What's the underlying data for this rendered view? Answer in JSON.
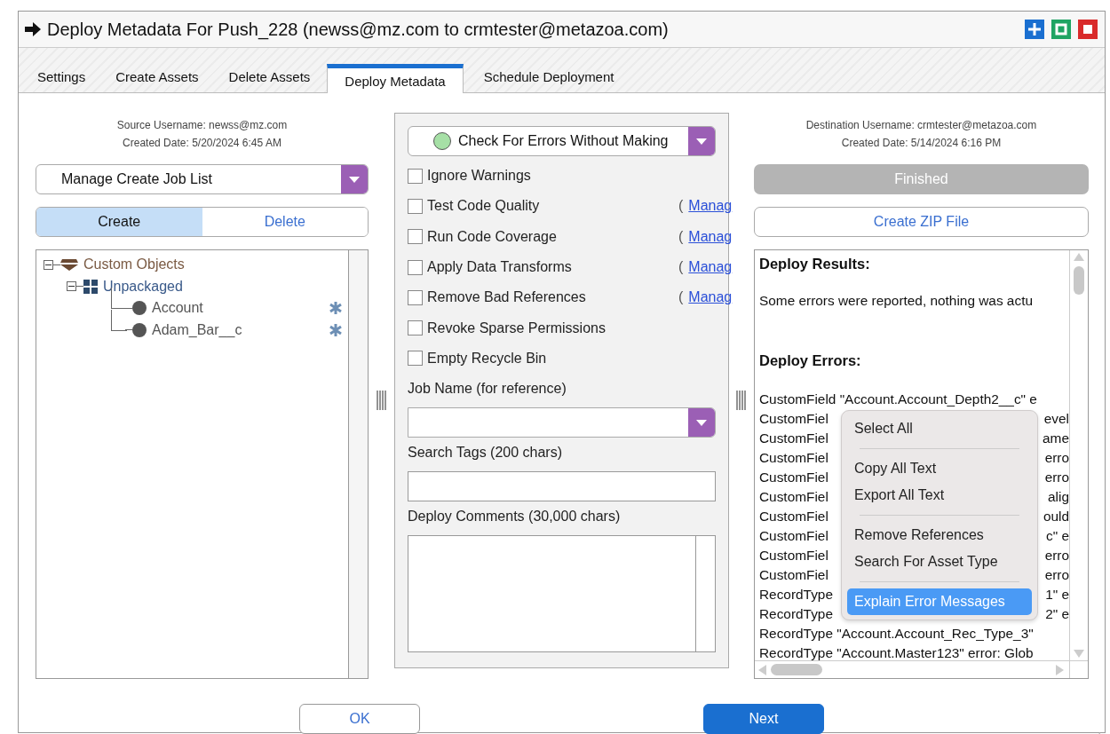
{
  "window": {
    "title": "Deploy Metadata For Push_228 (newss@mz.com to crmtester@metazoa.com)"
  },
  "tabs": [
    {
      "label": "Settings",
      "selected": false
    },
    {
      "label": "Create Assets",
      "selected": false
    },
    {
      "label": "Delete Assets",
      "selected": false
    },
    {
      "label": "Deploy Metadata",
      "selected": true
    },
    {
      "label": "Schedule Deployment",
      "selected": false
    }
  ],
  "source": {
    "username": "Source Username: newss@mz.com",
    "created_date": "Created Date: 5/20/2024 6:45 AM",
    "job_list_dropdown": "Manage Create Job List",
    "modes": [
      {
        "label": "Create",
        "selected": true
      },
      {
        "label": "Delete",
        "selected": false
      }
    ],
    "tree": [
      {
        "label": "Custom Objects",
        "kind": "category",
        "expanded": true,
        "children": [
          {
            "label": "Unpackaged",
            "kind": "package",
            "expanded": true,
            "children": [
              {
                "label": "Account",
                "kind": "item"
              },
              {
                "label": "Adam_Bar__c",
                "kind": "item"
              }
            ]
          }
        ]
      }
    ]
  },
  "options": {
    "deploy_mode": "Check For Errors Without Making",
    "checkboxes": [
      {
        "label": "Ignore Warnings",
        "checked": false
      },
      {
        "label": "Test Code Quality",
        "checked": false,
        "link_prefix": "(",
        "link": "Manag"
      },
      {
        "label": "Run Code Coverage",
        "checked": false,
        "link_prefix": "(",
        "link": "Manag"
      },
      {
        "label": "Apply Data Transforms",
        "checked": false,
        "link_prefix": "(",
        "link": "Manag"
      },
      {
        "label": "Remove Bad References",
        "checked": false,
        "link_prefix": "(",
        "link": "Manag"
      },
      {
        "label": "Revoke Sparse Permissions",
        "checked": false
      },
      {
        "label": "Empty Recycle Bin",
        "checked": false
      }
    ],
    "job_name_label": "Job Name (for reference)",
    "search_tags_label": "Search Tags (200 chars)",
    "comments_label": "Deploy Comments (30,000 chars)"
  },
  "destination": {
    "username": "Destination Username: crmtester@metazoa.com",
    "created_date": "Created Date: 5/14/2024 6:16 PM",
    "status_button": {
      "label": "Finished",
      "disabled": true
    },
    "zip_button": "Create ZIP File",
    "results": {
      "heading": "Deploy Results:",
      "summary": "Some errors were reported, nothing was actu",
      "errors_heading": "Deploy Errors:",
      "lines": [
        {
          "left": "CustomField \"Account.Account_Depth2__c\" e"
        },
        {
          "left": "CustomFiel",
          "right": "evel"
        },
        {
          "left": "CustomFiel",
          "right": "ame"
        },
        {
          "left": "CustomFiel",
          "right": "erro"
        },
        {
          "left": "CustomFiel",
          "right": "erro"
        },
        {
          "left": "CustomFiel",
          "right": "alig"
        },
        {
          "left": "CustomFiel",
          "right": "ould"
        },
        {
          "left": "CustomFiel",
          "right": "c\" e"
        },
        {
          "left": "CustomFiel",
          "right": "erro"
        },
        {
          "left": "CustomFiel",
          "right": "erro"
        },
        {
          "left": "RecordType",
          "right": "1\" e"
        },
        {
          "left": "RecordType",
          "right": "2\" e"
        },
        {
          "left": "RecordType \"Account.Account_Rec_Type_3\""
        },
        {
          "left": "RecordType \"Account.Master123\" error: Glob"
        }
      ]
    }
  },
  "context_menu": {
    "groups": [
      [
        {
          "label": "Select All",
          "selected": false
        }
      ],
      [
        {
          "label": "Copy All Text",
          "selected": false
        },
        {
          "label": "Export All Text",
          "selected": false
        }
      ],
      [
        {
          "label": "Remove References",
          "selected": false
        },
        {
          "label": "Search For Asset Type",
          "selected": false
        }
      ],
      [
        {
          "label": "Explain Error Messages",
          "selected": true
        }
      ]
    ]
  },
  "footer": {
    "buttons": [
      {
        "label": "OK",
        "kind": "secondary"
      },
      {
        "label": "Next",
        "kind": "primary"
      }
    ]
  }
}
